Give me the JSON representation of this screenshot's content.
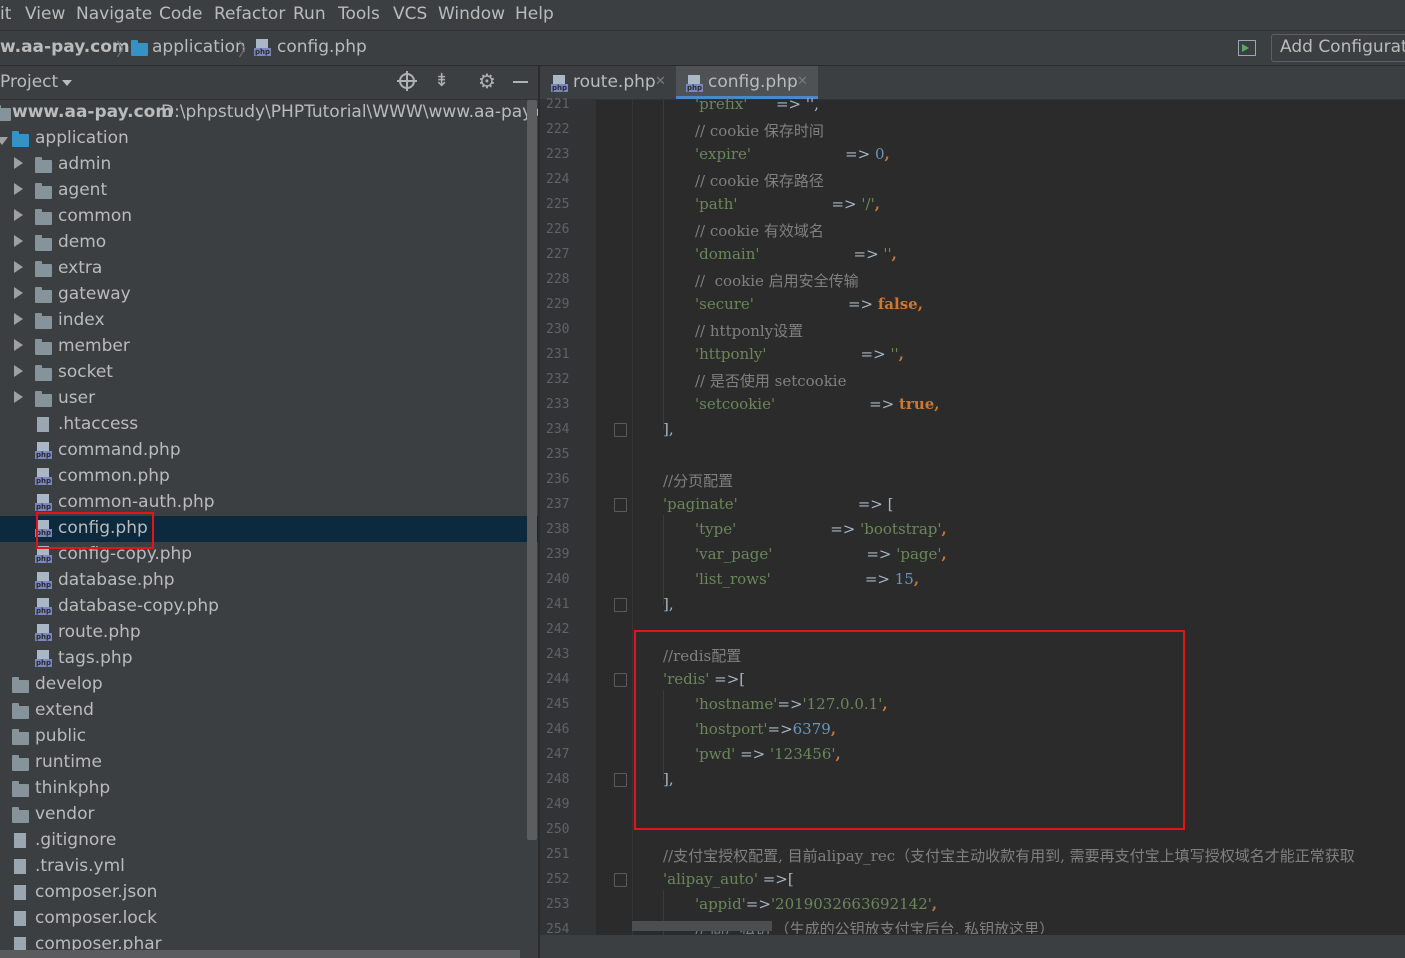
{
  "menu": [
    "it",
    "View",
    "Navigate",
    "Code",
    "Refactor",
    "Run",
    "Tools",
    "VCS",
    "Window",
    "Help"
  ],
  "nav": {
    "crumbs": [
      "w.aa-pay.com",
      "application",
      "config.php"
    ],
    "add_config": "Add Configuratio"
  },
  "project": {
    "header": "Project",
    "root_name": "www.aa-pay.com",
    "root_path": "D:\\phpstudy\\PHPTutorial\\WWW\\www.aa-pay.com",
    "items": [
      {
        "label": "application",
        "type": "folder-blue",
        "expanded": true
      },
      {
        "label": "admin",
        "type": "folder",
        "collapsed": true
      },
      {
        "label": "agent",
        "type": "folder",
        "collapsed": true
      },
      {
        "label": "common",
        "type": "folder",
        "collapsed": true
      },
      {
        "label": "demo",
        "type": "folder",
        "collapsed": true
      },
      {
        "label": "extra",
        "type": "folder",
        "collapsed": true
      },
      {
        "label": "gateway",
        "type": "folder",
        "collapsed": true
      },
      {
        "label": "index",
        "type": "folder",
        "collapsed": true
      },
      {
        "label": "member",
        "type": "folder",
        "collapsed": true
      },
      {
        "label": "socket",
        "type": "folder",
        "collapsed": true
      },
      {
        "label": "user",
        "type": "folder",
        "collapsed": true
      },
      {
        "label": ".htaccess",
        "type": "file"
      },
      {
        "label": "command.php",
        "type": "php"
      },
      {
        "label": "common.php",
        "type": "php"
      },
      {
        "label": "common-auth.php",
        "type": "php"
      },
      {
        "label": "config.php",
        "type": "php",
        "selected": true
      },
      {
        "label": "config-copy.php",
        "type": "php"
      },
      {
        "label": "database.php",
        "type": "php"
      },
      {
        "label": "database-copy.php",
        "type": "php"
      },
      {
        "label": "route.php",
        "type": "php"
      },
      {
        "label": "tags.php",
        "type": "php"
      },
      {
        "label": "develop",
        "type": "folder"
      },
      {
        "label": "extend",
        "type": "folder"
      },
      {
        "label": "public",
        "type": "folder"
      },
      {
        "label": "runtime",
        "type": "folder"
      },
      {
        "label": "thinkphp",
        "type": "folder"
      },
      {
        "label": "vendor",
        "type": "folder"
      },
      {
        "label": ".gitignore",
        "type": "file"
      },
      {
        "label": ".travis.yml",
        "type": "file"
      },
      {
        "label": "composer.json",
        "type": "file"
      },
      {
        "label": "composer.lock",
        "type": "file"
      },
      {
        "label": "composer.phar",
        "type": "file"
      }
    ]
  },
  "tabs": [
    {
      "label": "route.php",
      "active": false
    },
    {
      "label": "config.php",
      "active": true
    }
  ],
  "editor": {
    "line_numbers": [
      "221",
      "222",
      "223",
      "224",
      "225",
      "226",
      "227",
      "228",
      "229",
      "230",
      "231",
      "232",
      "233",
      "234",
      "235",
      "236",
      "237",
      "238",
      "239",
      "240",
      "241",
      "242",
      "243",
      "244",
      "245",
      "246",
      "247",
      "248",
      "249",
      "250",
      "251",
      "252",
      "253",
      "254"
    ],
    "lines": {
      "l221": "'prefix'",
      "l222": "// cookie 保存时间",
      "l223a": "'expire'",
      "l223b": "=> ",
      "l223c": "0",
      "l223d": ",",
      "l224": "// cookie 保存路径",
      "l225a": "'path'",
      "l225b": "=> ",
      "l225c": "'/'",
      "l225d": ",",
      "l226": "// cookie 有效域名",
      "l227a": "'domain'",
      "l227b": "=> ",
      "l227c": "''",
      "l227d": ",",
      "l228": "//  cookie 启用安全传输",
      "l229a": "'secure'",
      "l229b": "=> ",
      "l229c": "false",
      "l229d": ",",
      "l230": "// httponly设置",
      "l231a": "'httponly'",
      "l231b": "=> ",
      "l231c": "''",
      "l231d": ",",
      "l232": "// 是否使用 setcookie",
      "l233a": "'setcookie'",
      "l233b": "=> ",
      "l233c": "true",
      "l233d": ",",
      "l234": "],",
      "l236": "//分页配置",
      "l237a": "'paginate'",
      "l237b": "=> [",
      "l238a": "'type'",
      "l238b": "=> ",
      "l238c": "'bootstrap'",
      "l238d": ",",
      "l239a": "'var_page'",
      "l239b": "=> ",
      "l239c": "'page'",
      "l239d": ",",
      "l240a": "'list_rows'",
      "l240b": "=> ",
      "l240c": "15",
      "l240d": ",",
      "l241": "],",
      "l243": "//redis配置",
      "l244a": "'redis'",
      "l244b": " =>[",
      "l245a": "'hostname'",
      "l245b": "=>",
      "l245c": "'127.0.0.1'",
      "l245d": ",",
      "l246a": "'hostport'",
      "l246b": "=>",
      "l246c": "6379",
      "l246d": ",",
      "l247a": "'pwd'",
      "l247b": " => ",
      "l247c": "'123456'",
      "l247d": ",",
      "l248": "],",
      "l251": "//支付宝授权配置, 目前alipay_rec（支付宝主动收款有用到, 需要再支付宝上填写授权域名才能正常获取",
      "l252a": "'alipay_auto'",
      "l252b": " =>[",
      "l253a": "'appid'",
      "l253b": "=>",
      "l253c": "'2019032663692142'",
      "l253d": ",",
      "l254": "// 商户私钥 （生成的公钥放支付宝后台, 私钥放这里）"
    }
  },
  "colors": {
    "highlight": "#e0161b",
    "selection": "#0d293e",
    "string": "#6a8759",
    "keyword": "#cc7832",
    "number": "#6897bb",
    "comment": "#808080"
  }
}
